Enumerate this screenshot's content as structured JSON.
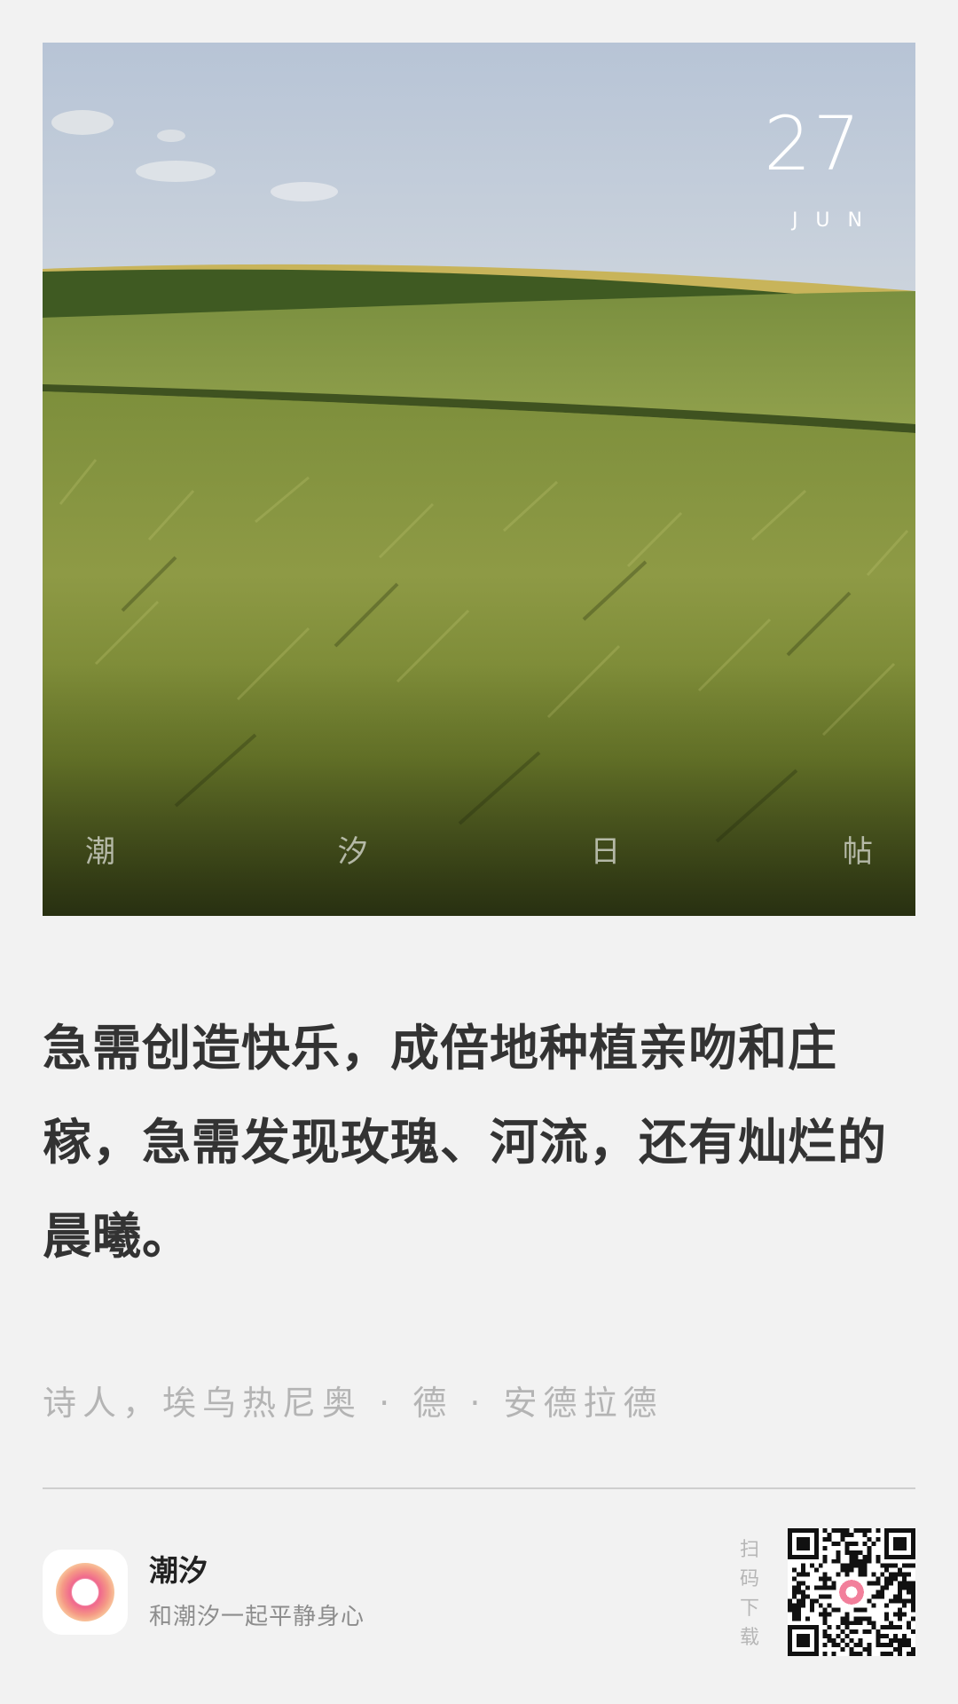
{
  "photo": {
    "date_day": "27",
    "date_month": "JUN",
    "tagline": [
      "潮",
      "汐",
      "日",
      "帖"
    ]
  },
  "quote": {
    "text": "急需创造快乐，成倍地种植亲吻和庄稼，急需发现玫瑰、河流，还有灿烂的晨曦。",
    "author": "诗人，埃乌热尼奥 · 德 · 安德拉德"
  },
  "footer": {
    "app_name": "潮汐",
    "app_slogan": "和潮汐一起平静身心",
    "scan_text": [
      "扫",
      "码",
      "下",
      "载"
    ],
    "app_icon": "tide-logo-icon",
    "qr_icon": "qr-code-icon"
  },
  "colors": {
    "background": "#f2f2f2",
    "quote_text": "#333333",
    "muted_text": "#b4b4b4",
    "logo_pink": "#f27f9b",
    "logo_orange": "#f6b47a"
  }
}
